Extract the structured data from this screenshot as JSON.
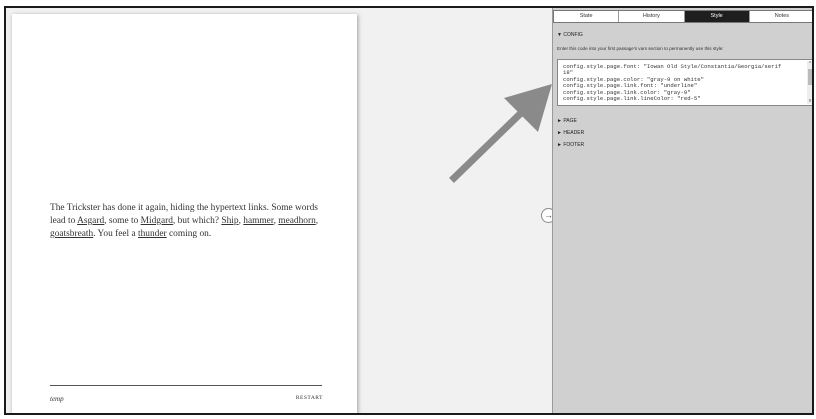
{
  "story": {
    "parts": [
      "The Trickster has done it again, hiding the hypertext links. Some words lead to ",
      "Asgard",
      ", some to ",
      "Midgard",
      ", but which? ",
      "Ship",
      ", ",
      "hammer",
      ", ",
      "meadhorn",
      ", ",
      "goatsbreath",
      ". You feel a ",
      "thunder",
      " coming on."
    ]
  },
  "footer": {
    "left": "temp",
    "right": "RESTART"
  },
  "toggle": {
    "glyph": "→"
  },
  "panel": {
    "tabs": [
      "State",
      "History",
      "Style",
      "Notes"
    ],
    "active_tab": "Style",
    "config_title": "▼ CONFIG",
    "description": "Enter this code into your first passage's vars section to permanently use this style:",
    "code_lines": [
      "config.style.page.font: \"Iowan Old Style/Constantia/Georgia/serif",
      "18\"",
      "config.style.page.color: \"gray-9 on white\"",
      "config.style.page.link.font: \"underline\"",
      "config.style.page.link.color: \"gray-9\"",
      "config.style.page.link.lineColor: \"red-5\""
    ],
    "sections": [
      "► PAGE",
      "► HEADER",
      "► FOOTER"
    ]
  },
  "colors": {
    "arrow": "#8a8a8a",
    "active_tab": "#1e1e1e",
    "panel": "#d0d0d0"
  }
}
